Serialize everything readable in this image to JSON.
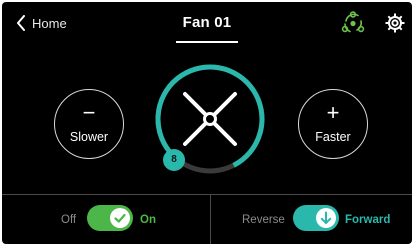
{
  "header": {
    "back_label": "Home",
    "title": "Fan 01",
    "icons": {
      "back": "chevron-left-icon",
      "hub": "hub-network-icon",
      "settings": "gear-icon"
    }
  },
  "speed": {
    "slower_symbol": "−",
    "slower_label": "Slower",
    "faster_symbol": "+",
    "faster_label": "Faster",
    "level": "8",
    "arc_fraction": 0.8
  },
  "power": {
    "off_label": "Off",
    "on_label": "On",
    "state": "on"
  },
  "direction": {
    "reverse_label": "Reverse",
    "forward_label": "Forward",
    "state": "forward"
  },
  "colors": {
    "accent_teal": "#2ab7ac",
    "power_green": "#4cb649",
    "hub_icon_green": "#6cc24a",
    "background": "#000000",
    "track_gray": "#3a3a3a"
  }
}
